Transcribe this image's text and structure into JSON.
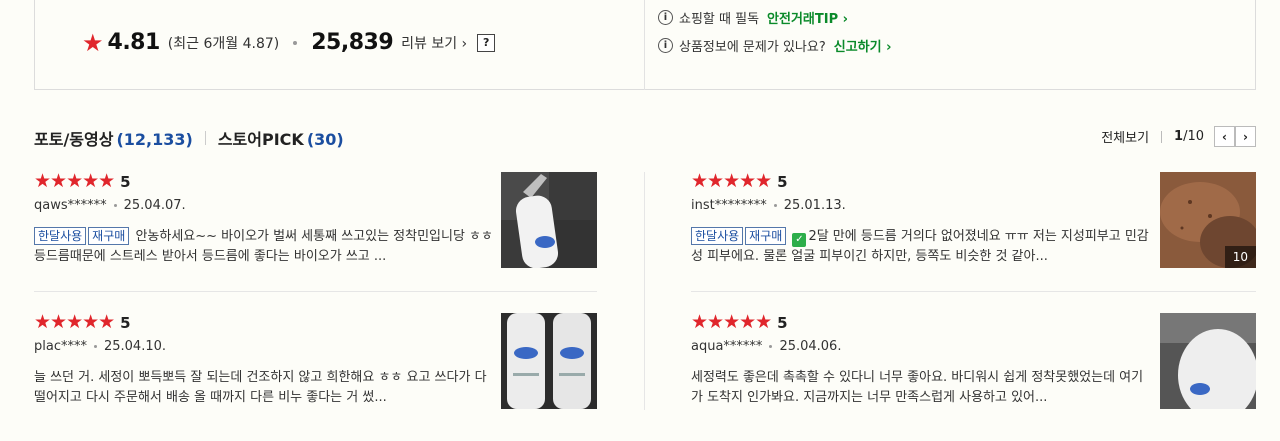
{
  "summary": {
    "rating": "4.81",
    "recent_rating": "(최근 6개월 4.87)",
    "review_count": "25,839",
    "review_link": "리뷰 보기 ›",
    "help": "?"
  },
  "notices": [
    {
      "text": "쇼핑할 때 필독",
      "link": "안전거래TIP ›"
    },
    {
      "text": "상품정보에 문제가 있나요?",
      "link": "신고하기 ›"
    }
  ],
  "tabs": [
    {
      "label": "포토/동영상",
      "count": "(12,133)"
    },
    {
      "label": "스토어PICK",
      "count": "(30)"
    }
  ],
  "pager": {
    "view_all": "전체보기",
    "current": "1",
    "total": "/10",
    "prev": "‹",
    "next": "›"
  },
  "reviews": [
    {
      "score": "5",
      "user": "qaws******",
      "date": "25.04.07.",
      "tags": [
        "한달사용",
        "재구매"
      ],
      "text": "안농하세요~~ 바이오가 벌써 세통째 쓰고있는 정착민입니당 ㅎㅎ 등드름때문에 스트레스 받아서 등드름에 좋다는 바이오가 쓰고 ..."
    },
    {
      "score": "5",
      "user": "inst********",
      "date": "25.01.13.",
      "tags": [
        "한달사용",
        "재구매"
      ],
      "text": "2달 만에 등드름 거의다 없어졌네요 ㅠㅠ 저는 지성피부고 민감성 피부에요. 물론 얼굴 피부이긴 하지만, 등쪽도 비슷한 것 같아...",
      "photo_count": "10"
    },
    {
      "score": "5",
      "user": "plac****",
      "date": "25.04.10.",
      "tags": [],
      "text": "늘 쓰던 거. 세정이 뽀득뽀득 잘 되는데 건조하지 않고 희한해요 ㅎㅎ 요고 쓰다가 다 떨어지고 다시 주문해서 배송 올 때까지 다른 비누 좋다는 거 썼..."
    },
    {
      "score": "5",
      "user": "aqua******",
      "date": "25.04.06.",
      "tags": [],
      "text": "세정력도 좋은데 촉촉할 수 있다니 너무 좋아요. 바디워시 쉽게 정착못했었는데 여기가 도착지 인가봐요. 지금까지는 너무 만족스럽게 사용하고 있어..."
    }
  ],
  "colors": {
    "star": "#e0262c",
    "count_blue": "#1b4ea0",
    "link_green": "#0a8a2a"
  }
}
